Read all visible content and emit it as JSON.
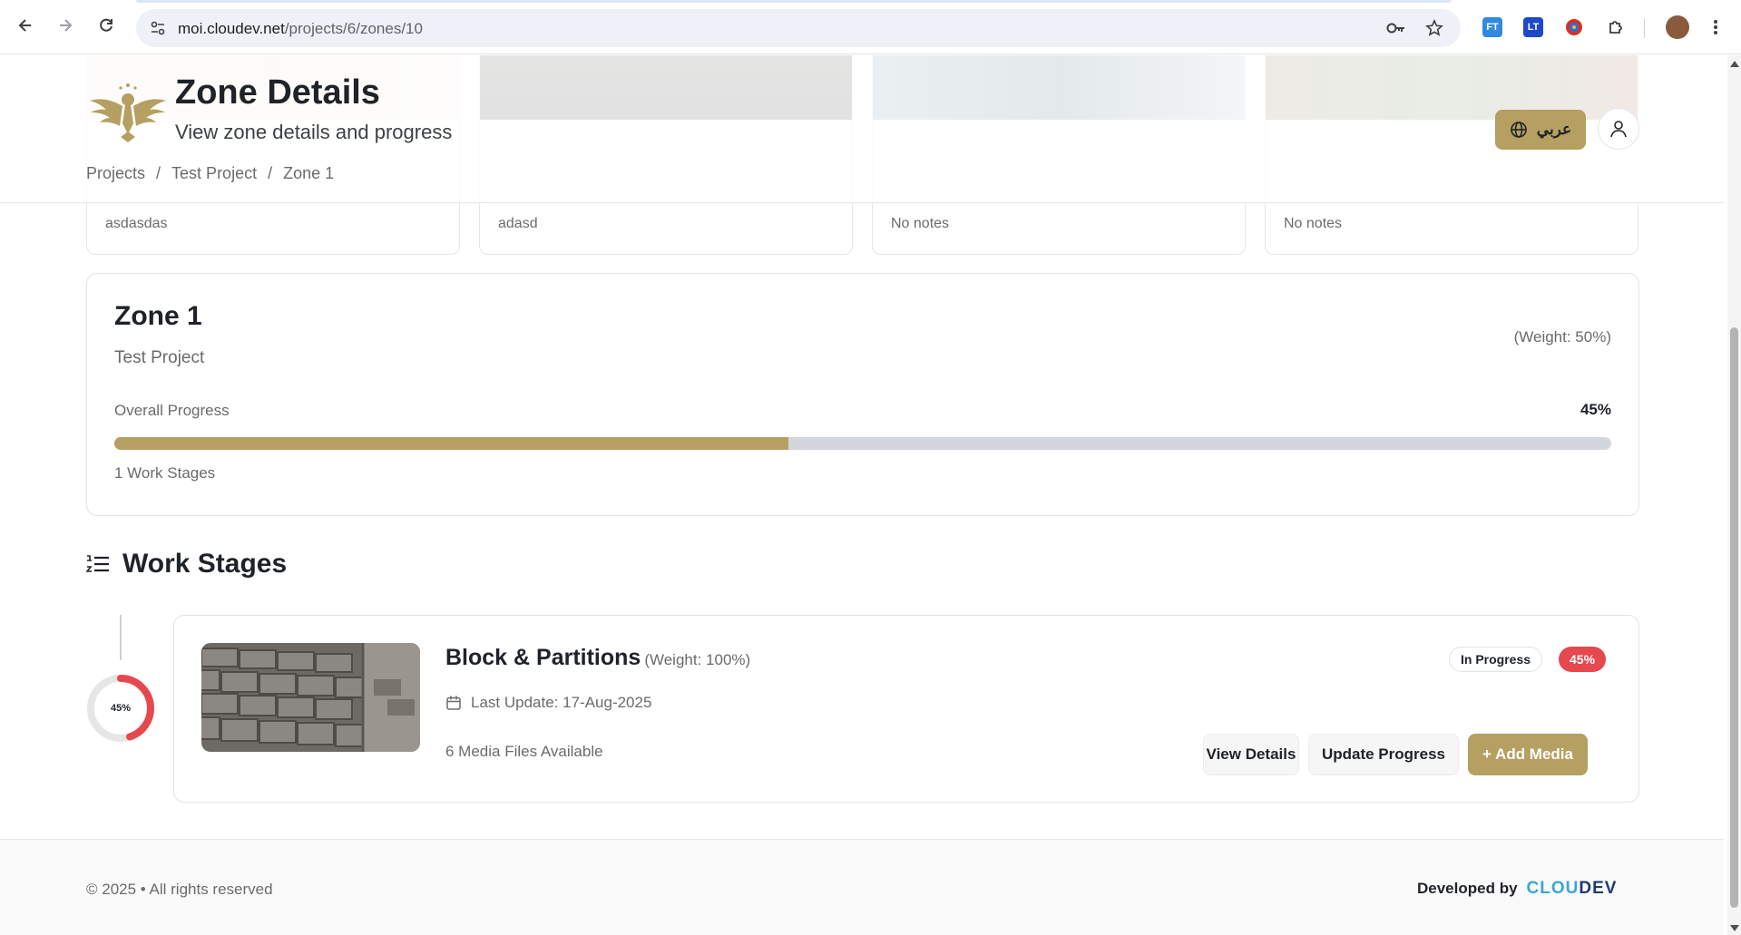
{
  "browser": {
    "url_host": "moi.cloudev.net",
    "url_path": "/projects/6/zones/10",
    "extensions": [
      "FT",
      "LT"
    ]
  },
  "background_cards": {
    "notes": [
      "asdasdas",
      "adasd",
      "No notes",
      "No notes"
    ]
  },
  "header": {
    "title": "Zone Details",
    "subtitle": "View zone details and progress",
    "language_button": "عربي",
    "breadcrumb": [
      "Projects",
      "Test Project",
      "Zone 1"
    ],
    "breadcrumb_sep": "/"
  },
  "zone": {
    "name": "Zone 1",
    "project": "Test Project",
    "weight": "(Weight: 50%)",
    "progress_label": "Overall Progress",
    "progress_value": "45%",
    "progress_fraction": 0.45,
    "stages_count": "1 Work Stages"
  },
  "work_stages": {
    "heading": "Work Stages",
    "items": [
      {
        "name": "Block & Partitions",
        "weight": "(Weight: 100%)",
        "last_update": "Last Update: 17-Aug-2025",
        "media": "6 Media Files Available",
        "status": "In Progress",
        "percent": "45%",
        "progress_fraction": 0.45,
        "buttons": {
          "view": "View Details",
          "update": "Update Progress",
          "add_media": "+ Add Media"
        }
      }
    ]
  },
  "footer": {
    "copyright": "© 2025 • All rights reserved",
    "developed_by": "Developed by",
    "brand_a": "CLOU",
    "brand_b": "DEV"
  },
  "colors": {
    "accent": "#b59f61",
    "danger": "#e5484d",
    "track": "#d3d6dc"
  }
}
